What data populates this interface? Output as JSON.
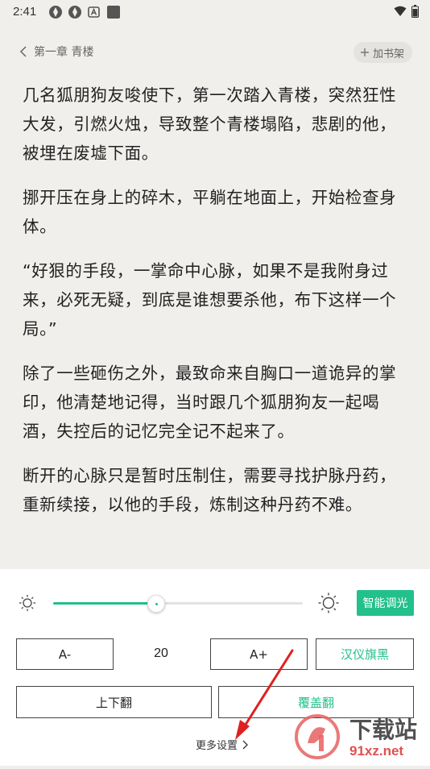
{
  "status_bar": {
    "time": "2:41",
    "icons_left": [
      "aperture-icon",
      "aperture-icon",
      "a-badge-icon",
      "square-icon"
    ],
    "icons_right": [
      "wifi-icon",
      "battery-icon"
    ]
  },
  "header": {
    "chapter_title": "第一章 青楼",
    "add_shelf_label": "加书架"
  },
  "content": {
    "paragraphs": [
      "几名狐朋狗友唆使下，第一次踏入青楼，突然狂性大发，引燃火烛，导致整个青楼塌陷，悲剧的他，被埋在废墟下面。",
      "挪开压在身上的碎木，平躺在地面上，开始检查身体。",
      "“好狠的手段，一掌命中心脉，如果不是我附身过来，必死无疑，到底是谁想要杀他，布下这样一个局。”",
      "除了一些砸伤之外，最致命来自胸口一道诡异的掌印，他清楚地记得，当时跟几个狐朋狗友一起喝酒，失控后的记忆完全记不起来了。",
      "断开的心脉只是暂时压制住，需要寻找护脉丹药，重新续接，以他的手段，炼制这种丹药不难。"
    ]
  },
  "settings": {
    "brightness_level": 0.41,
    "smart_dim_label": "智能调光",
    "font_decrease_label": "A-",
    "font_size": "20",
    "font_increase_label": "A+",
    "font_family_label": "汉仪旗黑",
    "page_turn_vertical_label": "上下翻",
    "page_turn_cover_label": "覆盖翻",
    "more_settings_label": "更多设置"
  },
  "watermark": {
    "brand_text": "下载站",
    "domain_text": "91xz.net"
  },
  "colors": {
    "accent": "#22c08a",
    "annotation_arrow": "#e02020",
    "page_bg": "#f1efec",
    "panel_bg": "#ffffff"
  }
}
